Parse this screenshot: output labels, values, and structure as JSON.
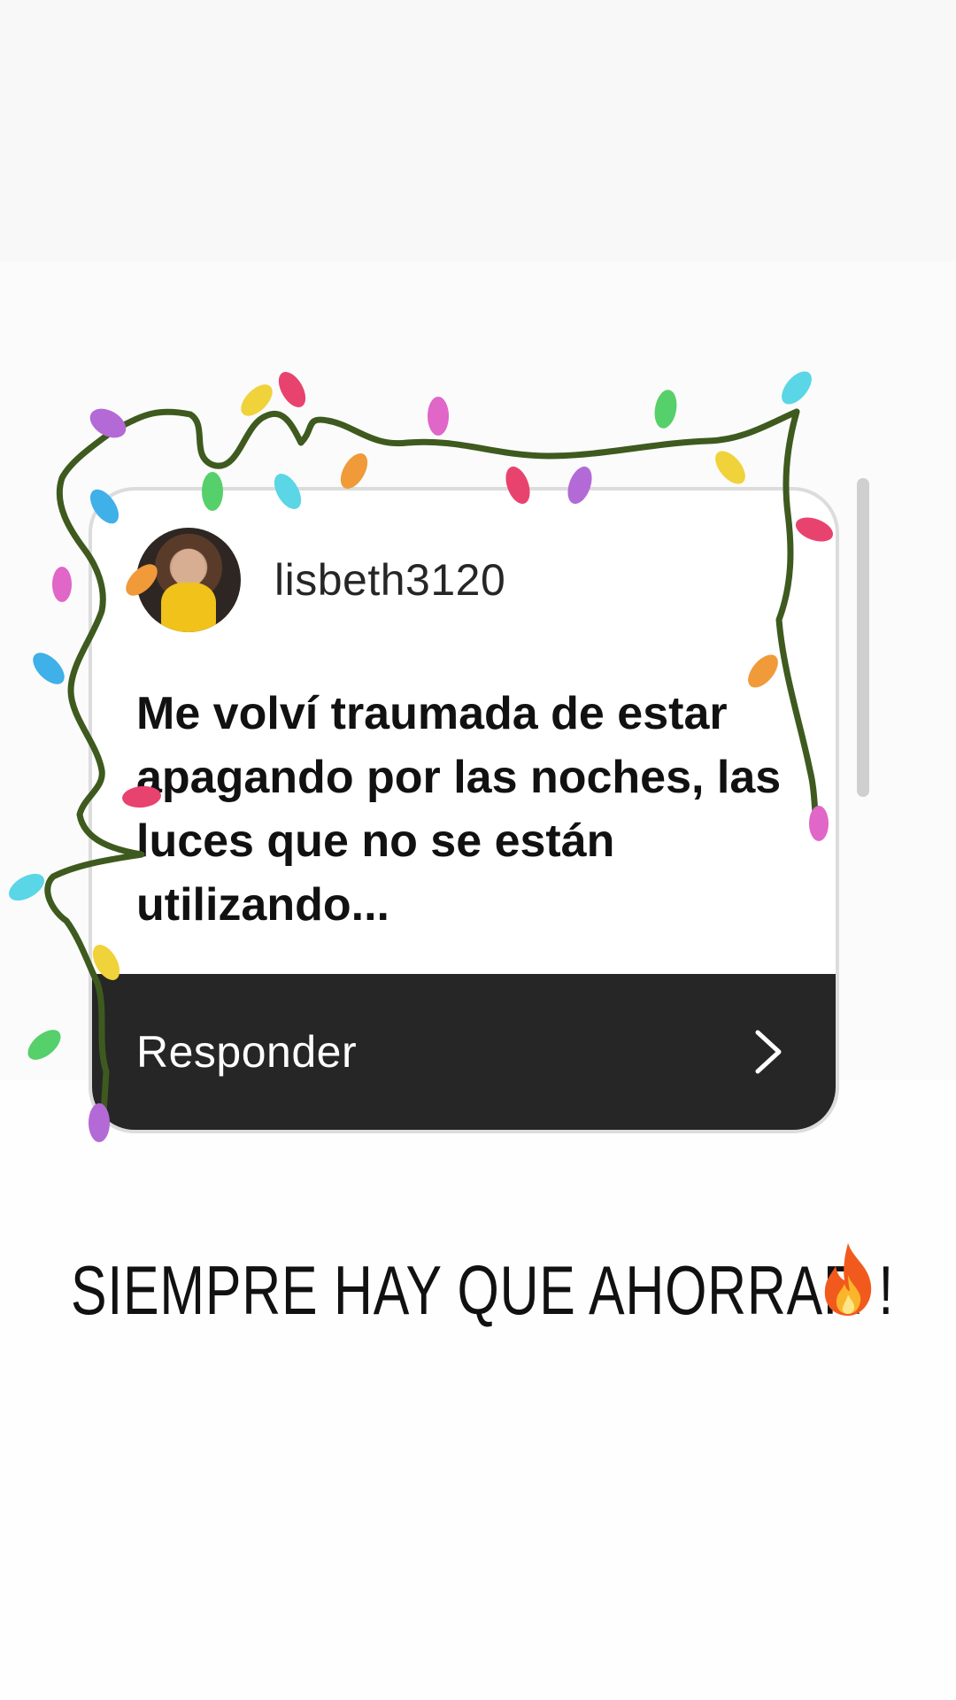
{
  "question_card": {
    "username": "lisbeth3120",
    "question_text": "Me volví traumada de estar apagando por las noches, las luces que no se están utilizando...",
    "reply_label": "Responder",
    "reply_icon": "chevron-right-icon"
  },
  "caption": {
    "text": "SIEMPRE HAY QUE AHORRAR !",
    "emoji_icon": "fire-icon"
  },
  "decoration": {
    "type": "christmas-lights-string",
    "wire_color": "#3e5a1e",
    "bulb_colors": [
      "#b36ad6",
      "#3fb0e8",
      "#e8436e",
      "#f0d23a",
      "#56d06a",
      "#f09a3a",
      "#e066c8",
      "#5ad6e6"
    ]
  },
  "colors": {
    "card_border": "#dcdcdc",
    "reply_bar": "#262626",
    "text_dark": "#111111"
  }
}
